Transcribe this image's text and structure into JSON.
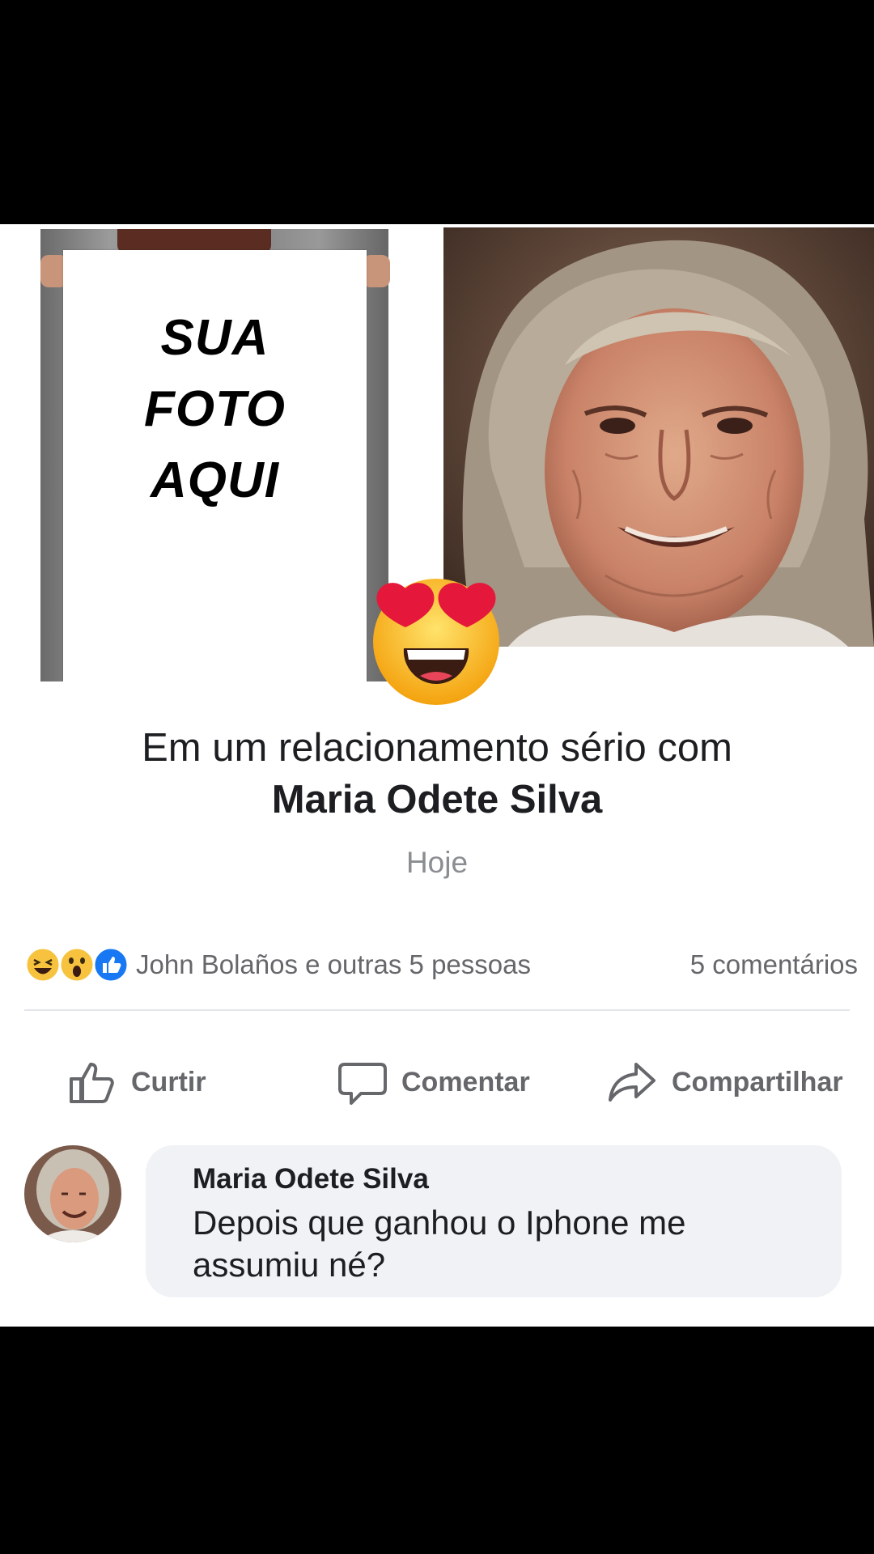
{
  "photo_sign": {
    "line1": "SUA",
    "line2": "FOTO",
    "line3": "AQUI"
  },
  "relationship": {
    "text": "Em um relacionamento sério com",
    "partner_name": "Maria Odete Silva",
    "date": "Hoje"
  },
  "reactions": {
    "icons": [
      "haha-icon",
      "wow-icon",
      "like-icon"
    ],
    "people_text": "John Bolaños e outras 5 pessoas",
    "comments_text": "5 comentários"
  },
  "actions": {
    "like_label": "Curtir",
    "comment_label": "Comentar",
    "share_label": "Compartilhar"
  },
  "comment": {
    "author": "Maria Odete Silva",
    "text": "Depois que ganhou o Iphone me assumiu né?"
  },
  "colors": {
    "background": "#000000",
    "card": "#ffffff",
    "text_primary": "#1c1e21",
    "text_secondary": "#65676b",
    "bubble": "#f0f2f5",
    "like_blue": "#1877f2"
  }
}
